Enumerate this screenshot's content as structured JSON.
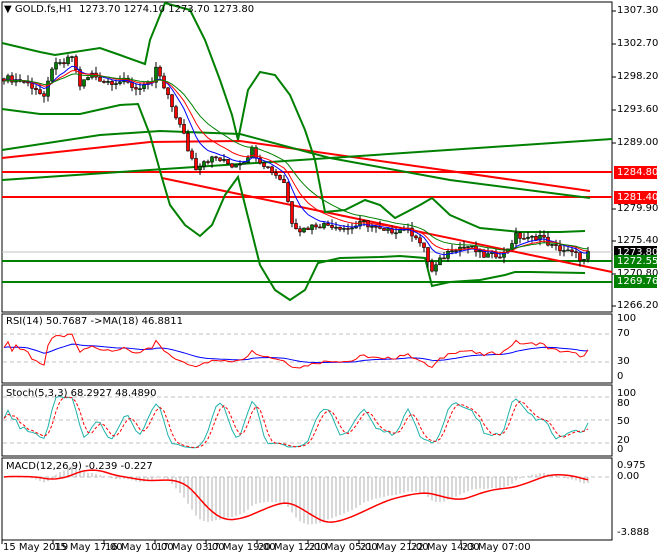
{
  "header": {
    "symbol": "GOLD.fs,H1",
    "open": "1273.70",
    "high": "1274.10",
    "low": "1273.70",
    "close": "1273.80"
  },
  "price_axis": [
    "1307.30",
    "1302.70",
    "1298.20",
    "1293.60",
    "1289.00",
    "1279.90",
    "1275.40",
    "1270.80",
    "1266.20"
  ],
  "price_tags": {
    "current": {
      "value": "1273.80",
      "color": "#000000"
    },
    "levels": [
      {
        "value": "1284.80",
        "color": "#ff0000"
      },
      {
        "value": "1281.40",
        "color": "#ff0000"
      },
      {
        "value": "1272.55",
        "color": "#008000"
      },
      {
        "value": "1269.76",
        "color": "#008000"
      }
    ]
  },
  "rsi": {
    "label": "RSI(14) 50.7687  ->MA(18) 46.8811",
    "axis": [
      "100",
      "70",
      "30",
      "0"
    ]
  },
  "stoch": {
    "label": "Stoch(5,3,3) 68.2927 48.4890",
    "axis": [
      "100",
      "80",
      "50",
      "20",
      "0"
    ]
  },
  "macd": {
    "label": "MACD(12,26,9) -0.239 -0.227",
    "axis": [
      "0.975",
      "0.00",
      "-3.888"
    ]
  },
  "time_axis": [
    "15 May 2019",
    "15 May 17:00",
    "16 May 10:00",
    "17 May 03:00",
    "17 May 19:00",
    "20 May 12:00",
    "21 May 05:00",
    "21 May 21:00",
    "22 May 14:00",
    "23 May 07:00"
  ],
  "price_path": [
    [
      0,
      1298
    ],
    [
      5,
      1297.5
    ],
    [
      8,
      1296.5
    ],
    [
      10,
      1295
    ],
    [
      12,
      1299.5
    ],
    [
      15,
      1300
    ],
    [
      17,
      1301
    ],
    [
      19,
      1297
    ],
    [
      22,
      1298.5
    ],
    [
      25,
      1297.5
    ],
    [
      30,
      1297.5
    ],
    [
      33,
      1296.5
    ],
    [
      35,
      1297
    ],
    [
      37,
      1297
    ],
    [
      38,
      1299.5
    ],
    [
      40,
      1296.5
    ],
    [
      42,
      1294
    ],
    [
      45,
      1290
    ],
    [
      46,
      1288
    ],
    [
      48,
      1285.5
    ],
    [
      50,
      1286.5
    ],
    [
      53,
      1286.8
    ],
    [
      57,
      1285.8
    ],
    [
      60,
      1286.5
    ],
    [
      62,
      1288
    ],
    [
      64,
      1286.5
    ],
    [
      67,
      1285
    ],
    [
      70,
      1283.5
    ],
    [
      72,
      1278
    ],
    [
      74,
      1276.8
    ],
    [
      78,
      1277.5
    ],
    [
      82,
      1277.5
    ],
    [
      86,
      1277
    ],
    [
      90,
      1277.8
    ],
    [
      95,
      1276.5
    ],
    [
      100,
      1277
    ],
    [
      103,
      1276
    ],
    [
      105,
      1274
    ],
    [
      107,
      1271
    ],
    [
      109,
      1272.5
    ],
    [
      112,
      1274.3
    ],
    [
      116,
      1274.5
    ],
    [
      120,
      1273.2
    ],
    [
      125,
      1273.5
    ],
    [
      128,
      1276
    ],
    [
      131,
      1275.5
    ],
    [
      134,
      1276
    ],
    [
      137,
      1274.5
    ],
    [
      140,
      1274
    ],
    [
      143,
      1273.3
    ],
    [
      145,
      1272.5
    ],
    [
      146,
      1273.8
    ]
  ],
  "colors": {
    "bull": "#008000",
    "bear": "#ff0000",
    "bands": "#008000",
    "trend": "#ff0000",
    "ma_fast": "#0000ff",
    "ma_mid": "#ff0000",
    "ma_slow": "#008000",
    "stoch_main": "#20b2aa"
  }
}
